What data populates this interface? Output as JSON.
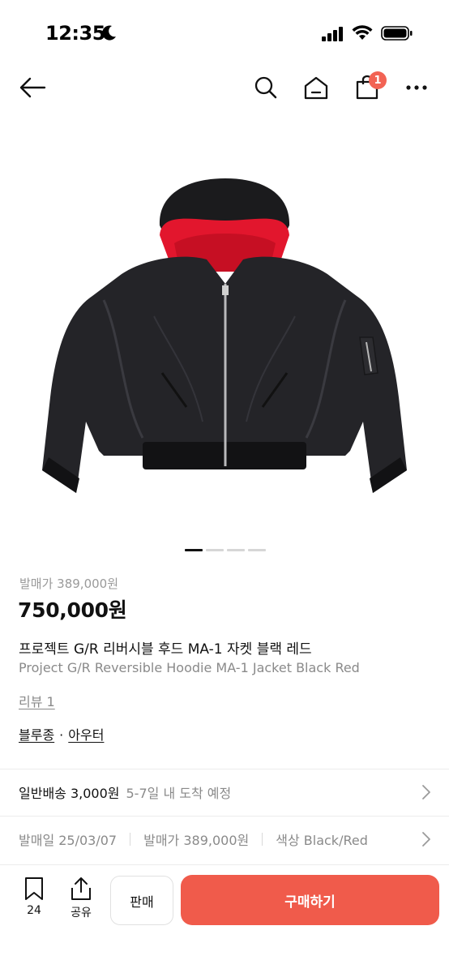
{
  "status_bar": {
    "time": "12:35"
  },
  "nav": {
    "cart_count": "1",
    "icons": [
      "back-arrow-icon",
      "search-icon",
      "home-icon",
      "shopping-bag-icon",
      "more-icon"
    ]
  },
  "carousel": {
    "total": 4,
    "active_index": 0
  },
  "product": {
    "original_price": "발매가 389,000원",
    "price": "750,000원",
    "title_ko": "프로젝트 G/R 리버시블 후드 MA-1 자켓 블랙 레드",
    "title_en": "Project G/R Reversible Hoodie MA-1 Jacket Black Red",
    "review_link": "리뷰 1",
    "category": {
      "primary": "블루종",
      "separator": "·",
      "secondary": "아우터"
    }
  },
  "shipping": {
    "main": "일반배송 3,000원",
    "sub": "5-7일 내 도착 예정"
  },
  "meta": {
    "release_date": "발매일 25/03/07",
    "release_price": "발매가 389,000원",
    "color": "색상 Black/Red"
  },
  "bottom_bar": {
    "bookmark_count": "24",
    "share_label": "공유",
    "sell_label": "판매",
    "buy_label": "구매하기"
  },
  "colors": {
    "accent": "#f05b4b",
    "badge": "#f26354",
    "muted_text": "#8a8a8a"
  }
}
